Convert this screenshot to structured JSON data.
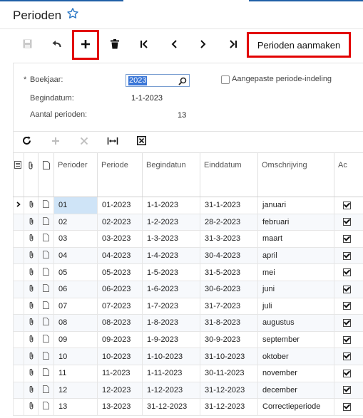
{
  "page": {
    "title": "Perioden"
  },
  "toolbar": {
    "action_label": "Perioden aanmaken"
  },
  "form": {
    "boekjaar_label": "Boekjaar:",
    "boekjaar_required": "*",
    "boekjaar_value": "2023",
    "begindatum_label": "Begindatum:",
    "begindatum_value": "1-1-2023",
    "aantal_label": "Aantal perioden:",
    "aantal_value": "13",
    "custom_label": "Aangepaste periode-indeling"
  },
  "grid": {
    "headers": [
      "Perioder",
      "Periode",
      "Begindatun",
      "Einddatum",
      "Omschrijving",
      "Ac"
    ],
    "rows": [
      {
        "nr": "01",
        "periode": "01-2023",
        "begin": "1-1-2023",
        "eind": "31-1-2023",
        "oms": "januari",
        "active": true
      },
      {
        "nr": "02",
        "periode": "02-2023",
        "begin": "1-2-2023",
        "eind": "28-2-2023",
        "oms": "februari",
        "active": true
      },
      {
        "nr": "03",
        "periode": "03-2023",
        "begin": "1-3-2023",
        "eind": "31-3-2023",
        "oms": "maart",
        "active": true
      },
      {
        "nr": "04",
        "periode": "04-2023",
        "begin": "1-4-2023",
        "eind": "30-4-2023",
        "oms": "april",
        "active": true
      },
      {
        "nr": "05",
        "periode": "05-2023",
        "begin": "1-5-2023",
        "eind": "31-5-2023",
        "oms": "mei",
        "active": true
      },
      {
        "nr": "06",
        "periode": "06-2023",
        "begin": "1-6-2023",
        "eind": "30-6-2023",
        "oms": "juni",
        "active": true
      },
      {
        "nr": "07",
        "periode": "07-2023",
        "begin": "1-7-2023",
        "eind": "31-7-2023",
        "oms": "juli",
        "active": true
      },
      {
        "nr": "08",
        "periode": "08-2023",
        "begin": "1-8-2023",
        "eind": "31-8-2023",
        "oms": "augustus",
        "active": true
      },
      {
        "nr": "09",
        "periode": "09-2023",
        "begin": "1-9-2023",
        "eind": "30-9-2023",
        "oms": "september",
        "active": true
      },
      {
        "nr": "10",
        "periode": "10-2023",
        "begin": "1-10-2023",
        "eind": "31-10-2023",
        "oms": "oktober",
        "active": true
      },
      {
        "nr": "11",
        "periode": "11-2023",
        "begin": "1-11-2023",
        "eind": "30-11-2023",
        "oms": "november",
        "active": true
      },
      {
        "nr": "12",
        "periode": "12-2023",
        "begin": "1-12-2023",
        "eind": "31-12-2023",
        "oms": "december",
        "active": true
      },
      {
        "nr": "13",
        "periode": "13-2023",
        "begin": "31-12-2023",
        "eind": "31-12-2023",
        "oms": "Correctieperiode",
        "active": true
      }
    ]
  },
  "colors": {
    "accent": "#1f5fa6",
    "highlight": "#e20000",
    "selected_cell": "#cfe4f7"
  },
  "icons": [
    "star-icon",
    "save-icon",
    "undo-icon",
    "add-icon",
    "delete-icon",
    "first-icon",
    "prev-icon",
    "next-icon",
    "last-icon",
    "search-icon",
    "refresh-icon",
    "close-icon",
    "fit-columns-icon",
    "export-excel-icon",
    "row-selector-icon",
    "attachment-icon",
    "note-icon",
    "checkbox-icon"
  ]
}
